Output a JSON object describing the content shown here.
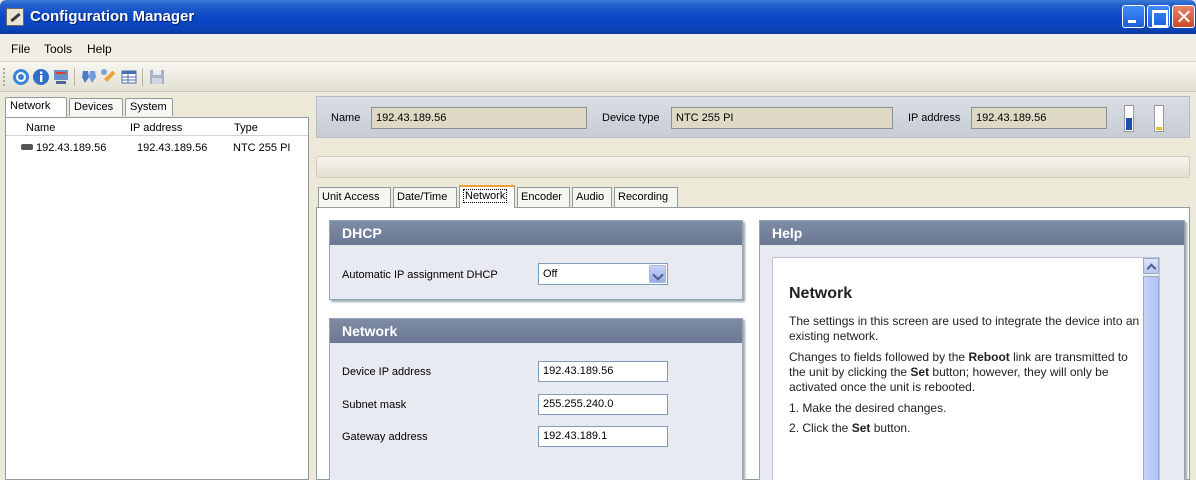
{
  "window": {
    "title": "Configuration Manager"
  },
  "menu": {
    "file": "File",
    "tools": "Tools",
    "help": "Help"
  },
  "left": {
    "tabs": [
      "Network",
      "Devices",
      "System"
    ],
    "columns": [
      "Name",
      "IP address",
      "Type"
    ],
    "rows": [
      {
        "name": "192.43.189.56",
        "ip": "192.43.189.56",
        "type": "NTC 255 PI"
      }
    ]
  },
  "info": {
    "name_label": "Name",
    "name_value": "192.43.189.56",
    "type_label": "Device type",
    "type_value": "NTC 255 PI",
    "ip_label": "IP address",
    "ip_value": "192.43.189.56"
  },
  "tabs": [
    "Unit Access",
    "Date/Time",
    "Network",
    "Encoder",
    "Audio",
    "Recording"
  ],
  "dhcp": {
    "title": "DHCP",
    "label": "Automatic IP assignment DHCP",
    "value": "Off"
  },
  "network": {
    "title": "Network",
    "device_ip_label": "Device IP address",
    "device_ip": "192.43.189.56",
    "subnet_label": "Subnet mask",
    "subnet": "255.255.240.0",
    "gateway_label": "Gateway address",
    "gateway": "192.43.189.1"
  },
  "help": {
    "title": "Help",
    "heading": "Network",
    "p1": "The settings in this screen are used to integrate the device into an existing network.",
    "p2_a": "Changes to fields followed by the ",
    "p2_b": "Reboot",
    "p2_c": " link are transmitted to the unit by clicking the ",
    "p2_d": "Set",
    "p2_e": " button; however, they will only be activated once the unit is rebooted.",
    "step1": "1.   Make the desired changes.",
    "step2_a": "2.   Click the ",
    "step2_b": "Set",
    "step2_c": " button."
  },
  "colors": {
    "accent_tab": "#f0a030",
    "box_header": "#6b7893",
    "titlebar": "#0a48c8"
  }
}
